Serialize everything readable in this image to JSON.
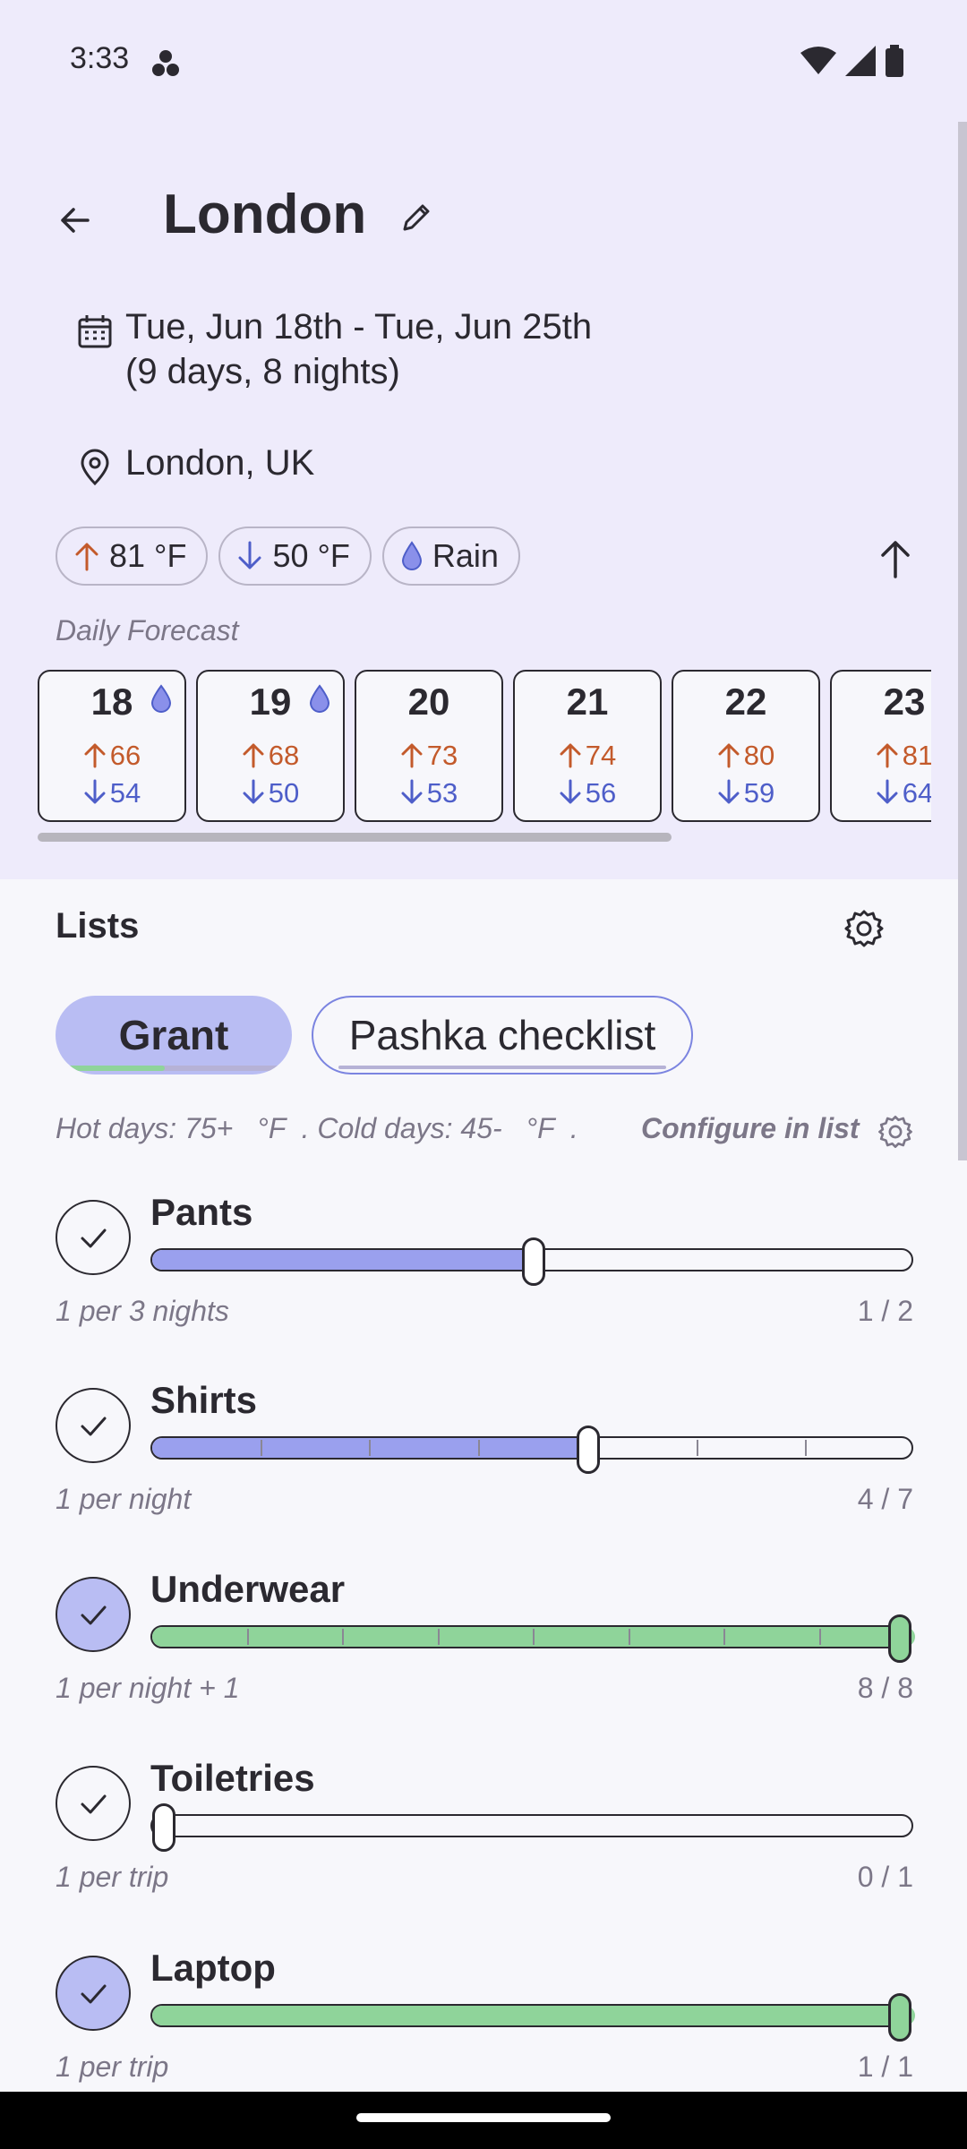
{
  "status_bar": {
    "time": "3:33"
  },
  "header": {
    "title": "London"
  },
  "trip": {
    "dates": "Tue, Jun 18th - Tue, Jun 25th",
    "duration": "(9 days, 8 nights)",
    "location": "London, UK"
  },
  "weather_chips": {
    "high": "81 °F",
    "low": "50 °F",
    "condition": "Rain"
  },
  "daily_forecast_label": "Daily Forecast",
  "forecast": [
    {
      "day": "18",
      "high": "66",
      "low": "54",
      "rain": true
    },
    {
      "day": "19",
      "high": "68",
      "low": "50",
      "rain": true
    },
    {
      "day": "20",
      "high": "73",
      "low": "53",
      "rain": false
    },
    {
      "day": "21",
      "high": "74",
      "low": "56",
      "rain": false
    },
    {
      "day": "22",
      "high": "80",
      "low": "59",
      "rain": false
    },
    {
      "day": "23",
      "high": "81",
      "low": "64",
      "rain": false
    }
  ],
  "lists": {
    "title": "Lists",
    "tabs": [
      {
        "label": "Grant",
        "active": true
      },
      {
        "label": "Pashka checklist",
        "active": false
      }
    ],
    "rule_text": "Hot days: 75+   °F  . Cold days: 45-   °F  .",
    "configure_label": "Configure in list"
  },
  "items": [
    {
      "name": "Pants",
      "rate": "1 per 3 nights",
      "count": "1 / 2",
      "packed": 1,
      "total": 2,
      "checked": false
    },
    {
      "name": "Shirts",
      "rate": "1 per night",
      "count": "4 / 7",
      "packed": 4,
      "total": 7,
      "checked": false
    },
    {
      "name": "Underwear",
      "rate": "1 per night + 1",
      "count": "8 / 8",
      "packed": 8,
      "total": 8,
      "checked": true
    },
    {
      "name": "Toiletries",
      "rate": "1 per trip",
      "count": "0 / 1",
      "packed": 0,
      "total": 1,
      "checked": false
    },
    {
      "name": "Laptop",
      "rate": "1 per trip",
      "count": "1 / 1",
      "packed": 1,
      "total": 1,
      "checked": true
    }
  ],
  "colors": {
    "accent": "#b9bdf3",
    "partial_fill": "#9aa0ee",
    "complete_fill": "#8fd49a",
    "high_temp": "#c35a2b",
    "low_temp": "#4e5ec9"
  }
}
